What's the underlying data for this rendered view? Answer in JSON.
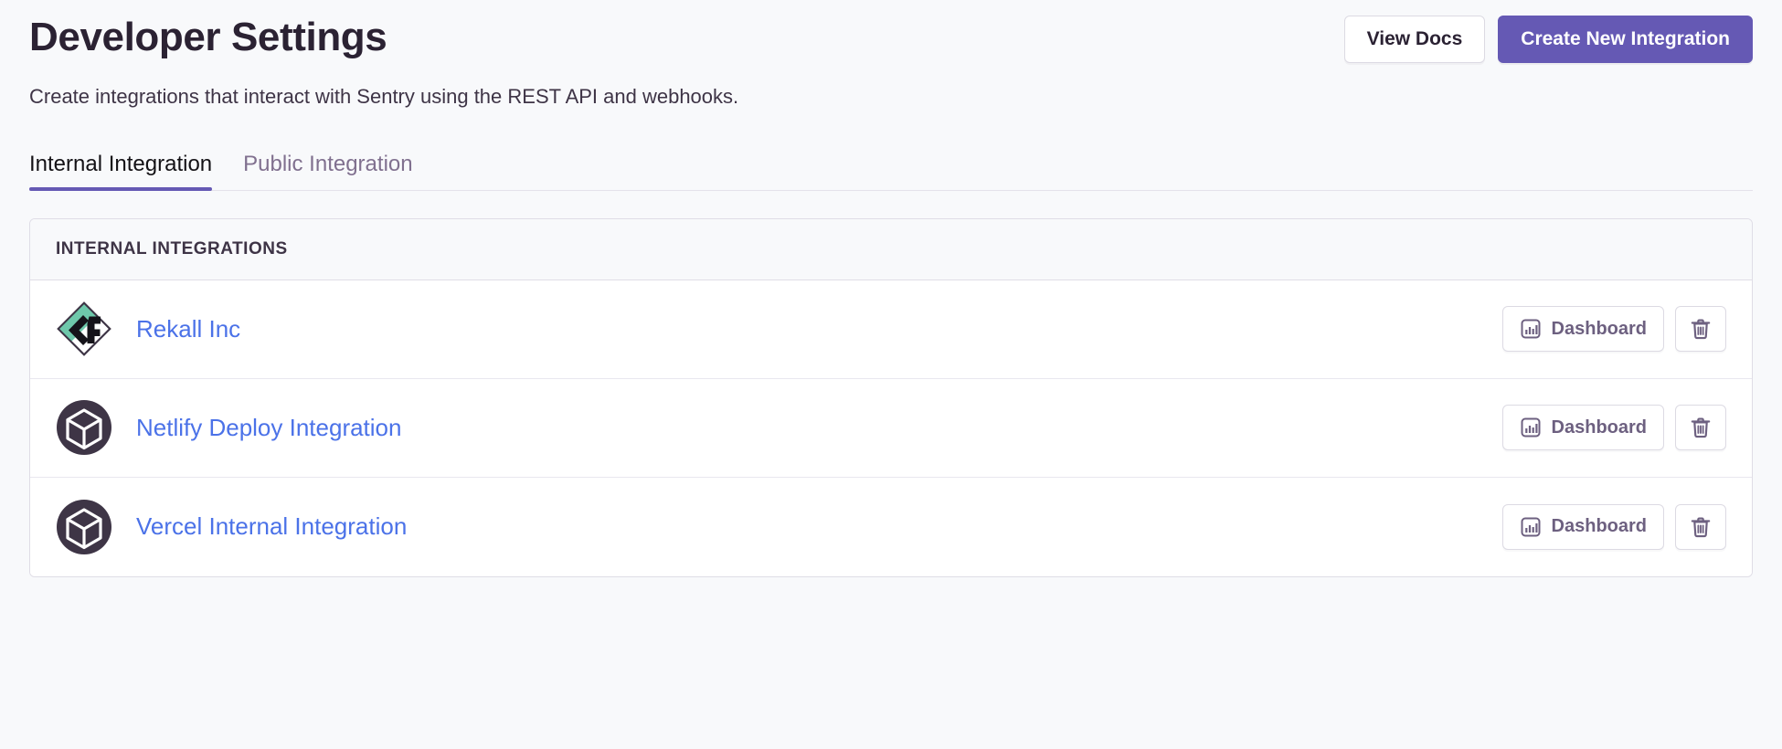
{
  "header": {
    "title": "Developer Settings",
    "subtitle": "Create integrations that interact with Sentry using the REST API and webhooks.",
    "actions": {
      "view_docs_label": "View Docs",
      "create_label": "Create New Integration"
    }
  },
  "tabs": [
    {
      "label": "Internal Integration",
      "active": true
    },
    {
      "label": "Public Integration",
      "active": false
    }
  ],
  "panel": {
    "header_label": "INTERNAL INTEGRATIONS",
    "rows": [
      {
        "name": "Rekall Inc",
        "avatar_icon": "rekall-diamond-logo-icon",
        "dashboard_label": "Dashboard",
        "dashboard_icon": "bar-chart-icon",
        "delete_icon": "trash-icon"
      },
      {
        "name": "Netlify Deploy Integration",
        "avatar_icon": "cube-circle-logo-icon",
        "dashboard_label": "Dashboard",
        "dashboard_icon": "bar-chart-icon",
        "delete_icon": "trash-icon"
      },
      {
        "name": "Vercel Internal Integration",
        "avatar_icon": "cube-circle-logo-icon",
        "dashboard_label": "Dashboard",
        "dashboard_icon": "bar-chart-icon",
        "delete_icon": "trash-icon"
      }
    ]
  },
  "colors": {
    "accent": "#6559b4",
    "link": "#4b72e8",
    "page_bg": "#f8f9fb",
    "panel_bg": "#ffffff",
    "text": "#2b2233",
    "muted_text": "#80708f",
    "border": "#dfdde6",
    "logo_teal": "#6ec8ab",
    "logo_dark": "#3e3546"
  }
}
